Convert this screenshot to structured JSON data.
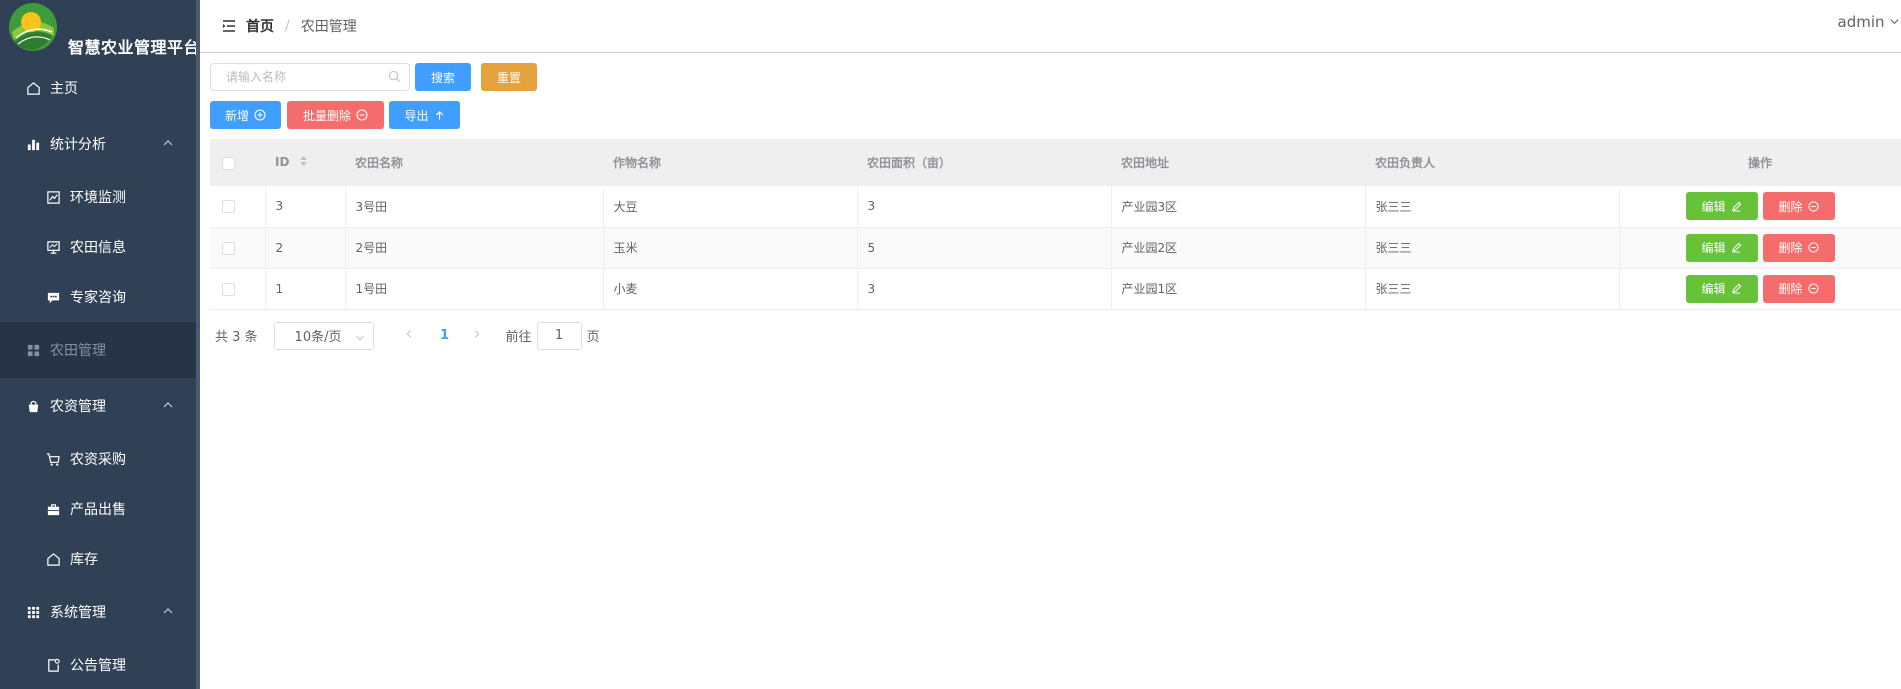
{
  "brand": {
    "title": "智慧农业管理平台"
  },
  "sidebar": {
    "items": [
      {
        "label": "主页"
      },
      {
        "label": "统计分析"
      },
      {
        "label": "环境监测"
      },
      {
        "label": "农田信息"
      },
      {
        "label": "专家咨询"
      },
      {
        "label": "农田管理"
      },
      {
        "label": "农资管理"
      },
      {
        "label": "农资采购"
      },
      {
        "label": "产品出售"
      },
      {
        "label": "库存"
      },
      {
        "label": "系统管理"
      },
      {
        "label": "公告管理"
      }
    ],
    "colors": {
      "background": "#304156",
      "active_background": "#263445",
      "active_text": "#8391a5"
    }
  },
  "header": {
    "breadcrumb_home": "首页",
    "breadcrumb_sep": "/",
    "breadcrumb_current": "农田管理",
    "username": "admin"
  },
  "search": {
    "placeholder": "请输入名称",
    "value": "",
    "search_button": "搜索",
    "reset_button": "重置"
  },
  "actions": {
    "add_label": "新增",
    "batch_delete_label": "批量删除",
    "export_label": "导出"
  },
  "table": {
    "headers": {
      "id": "ID",
      "name": "农田名称",
      "crop": "作物名称",
      "area": "农田面积（亩）",
      "address": "农田地址",
      "manager": "农田负责人",
      "ops": "操作"
    },
    "edit_label": "编辑",
    "delete_label": "删除",
    "rows": [
      {
        "id": "3",
        "name": "3号田",
        "crop": "大豆",
        "area": "3",
        "address": "产业园3区",
        "manager": "张三三"
      },
      {
        "id": "2",
        "name": "2号田",
        "crop": "玉米",
        "area": "5",
        "address": "产业园2区",
        "manager": "张三三"
      },
      {
        "id": "1",
        "name": "1号田",
        "crop": "小麦",
        "area": "3",
        "address": "产业园1区",
        "manager": "张三三"
      }
    ]
  },
  "pagination": {
    "total_text": "共 3 条",
    "page_size": "10条/页",
    "current_page": "1",
    "goto_label": "前往",
    "goto_value": "1",
    "page_unit": "页"
  },
  "colors": {
    "primary": "#409eff",
    "warning": "#e6a23c",
    "danger": "#f56c6c",
    "success": "#67c23a"
  }
}
